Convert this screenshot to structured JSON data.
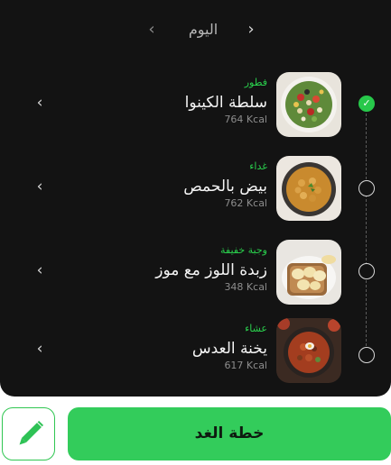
{
  "day_nav": {
    "label": "اليوم",
    "prev_icon": "chevron-left-icon",
    "next_icon": "chevron-right-icon"
  },
  "meals": [
    {
      "type": "فطور",
      "name": "سلطة الكينوا",
      "kcal": "764 Kcal",
      "completed": true
    },
    {
      "type": "غداء",
      "name": "بيض بالحمص",
      "kcal": "762 Kcal",
      "completed": false
    },
    {
      "type": "وجبة خفيفة",
      "name": "زبدة اللوز مع موز",
      "kcal": "348 Kcal",
      "completed": false
    },
    {
      "type": "عشاء",
      "name": "يخنة العدس",
      "kcal": "617 Kcal",
      "completed": false
    }
  ],
  "actions": {
    "primary_label": "خطة الغد",
    "edit_icon": "pencil-icon"
  },
  "colors": {
    "background": "#131313",
    "accent": "#33cc5b",
    "meal_type": "#2ad04d"
  }
}
